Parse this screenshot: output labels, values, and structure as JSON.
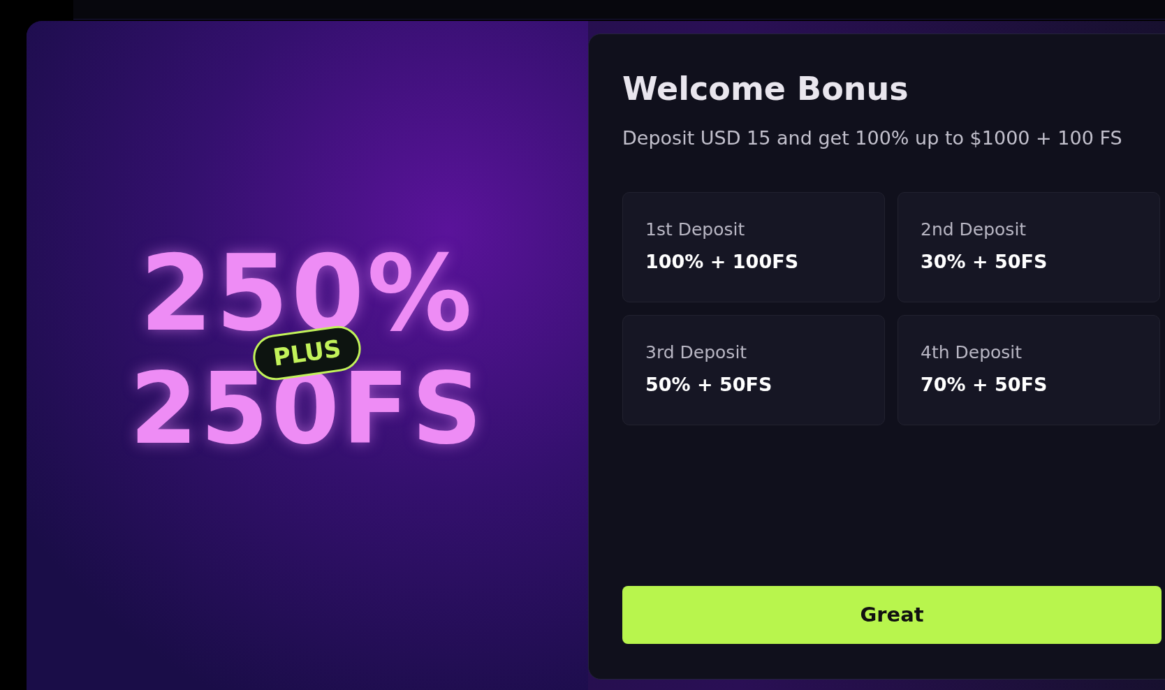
{
  "promo": {
    "headline": "250%",
    "badge": "PLUS",
    "subline": "250FS"
  },
  "bonus": {
    "title": "Welcome Bonus",
    "subtitle": "Deposit USD 15 and get 100% up to $1000 + 100 FS",
    "deposits": [
      {
        "label": "1st Deposit",
        "value": "100% + 100FS"
      },
      {
        "label": "2nd Deposit",
        "value": "30% + 50FS"
      },
      {
        "label": "3rd Deposit",
        "value": "50% + 50FS"
      },
      {
        "label": "4th Deposit",
        "value": "70% + 50FS"
      }
    ],
    "button": "Great"
  }
}
